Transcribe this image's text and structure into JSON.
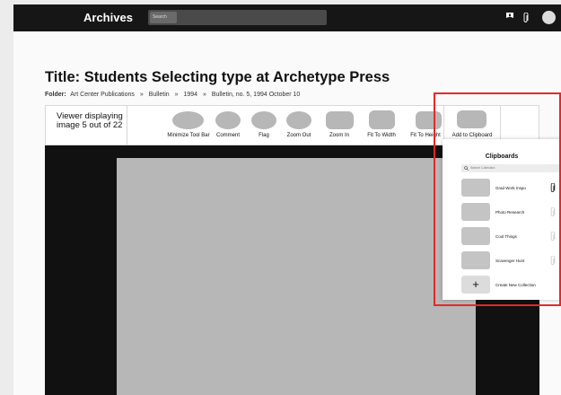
{
  "header": {
    "logo": "Archives",
    "search_placeholder": "Search"
  },
  "page": {
    "title": "Title: Students Selecting type at Archetype Press",
    "folder_label": "Folder:",
    "breadcrumb": [
      "Art Center Publications",
      "Bulletin",
      "1994",
      "Bulletin, no. 5, 1994 October 10"
    ],
    "breadcrumb_separator": "»"
  },
  "toolbar": {
    "viewer_info_line1": "Viewer displaying",
    "viewer_info_line2": "image 5 out of 22",
    "buttons": [
      {
        "label": "Minimize Tool Bar"
      },
      {
        "label": "Comment"
      },
      {
        "label": "Flag"
      },
      {
        "label": "Zoom Out"
      },
      {
        "label": "Zoom In"
      },
      {
        "label": "Fit To Width"
      },
      {
        "label": "Fit To Height"
      },
      {
        "label": "Add to Clipboard"
      }
    ]
  },
  "clipboards": {
    "title": "Clipboards",
    "search_placeholder": "Search Collection",
    "items": [
      {
        "label": "Grad Work Inspo",
        "clipped": true
      },
      {
        "label": "Photo Research",
        "clipped": false
      },
      {
        "label": "Cool Things",
        "clipped": false
      },
      {
        "label": "Scavenger Hunt",
        "clipped": false
      }
    ],
    "create_icon": "+",
    "create_label": "Create New Collection"
  },
  "colors": {
    "topbar": "#161616",
    "placeholder": "#b7b7b7",
    "highlight": "#e42929"
  },
  "icons": {
    "header": [
      "flag-icon",
      "paperclip-icon",
      "avatar"
    ],
    "clipboard_rows": "paperclip-icon"
  }
}
